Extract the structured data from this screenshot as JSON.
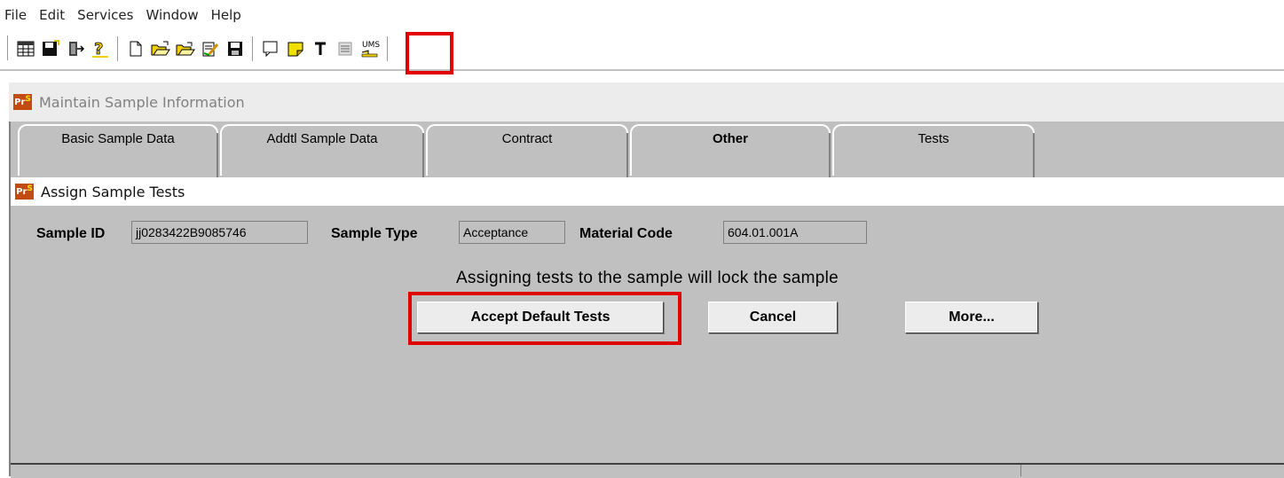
{
  "menu": [
    "File",
    "Edit",
    "Services",
    "Window",
    "Help"
  ],
  "toolbar": {
    "buttons": [
      "table-icon",
      "save-floppy-icon",
      "exit-door-icon",
      "help-icon",
      "new-document-icon",
      "open-folder-icon",
      "open-folder-alt-icon",
      "edit-document-icon",
      "save-icon",
      "comment-icon",
      "note-icon",
      "text-icon",
      "list-icon",
      "ums-icon"
    ],
    "ums_label": "UMS"
  },
  "window": {
    "title": "Maintain Sample Information",
    "icon_text": "Pr",
    "icon_sup": "S"
  },
  "tabs": [
    {
      "label": "Basic Sample Data"
    },
    {
      "label": "Addtl Sample Data"
    },
    {
      "label": "Contract"
    },
    {
      "label": "Other",
      "active": true
    },
    {
      "label": "Tests"
    }
  ],
  "dialog": {
    "title": "Assign Sample Tests",
    "sample_id_label": "Sample ID",
    "sample_id_value": "jj0283422B9085746",
    "sample_type_label": "Sample Type",
    "sample_type_value": "Acceptance",
    "material_code_label": "Material Code",
    "material_code_value": "604.01.001A",
    "message": "Assigning tests to the sample will lock the sample",
    "accept_label": "Accept Default Tests",
    "cancel_label": "Cancel",
    "more_label": "More..."
  },
  "colors": {
    "highlight": "#e00000",
    "panel": "#c0c0c0",
    "icon_bg": "#c34b0f"
  }
}
